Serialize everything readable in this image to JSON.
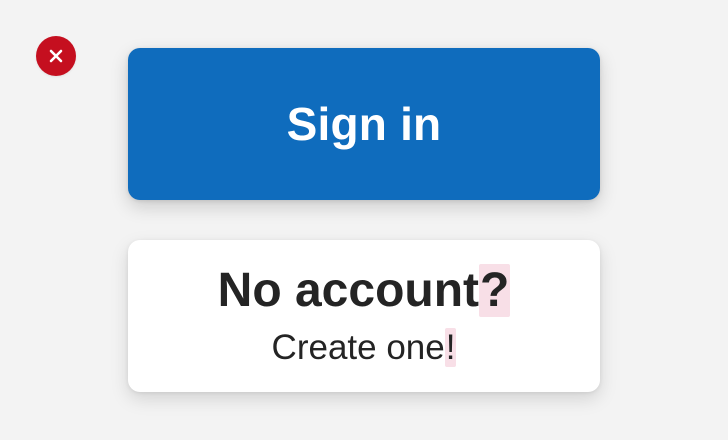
{
  "status": {
    "icon": "error-x-icon",
    "color": "#c50f1f"
  },
  "actions": {
    "sign_in_label": "Sign in",
    "create_account": {
      "title_main": "No account",
      "title_punctuation": "?",
      "subtitle_main": "Create one",
      "subtitle_punctuation": "!"
    }
  },
  "colors": {
    "background": "#f3f3f3",
    "primary": "#0f6cbd",
    "card": "#ffffff",
    "text": "#242424",
    "highlight": "#f8dfe7"
  }
}
